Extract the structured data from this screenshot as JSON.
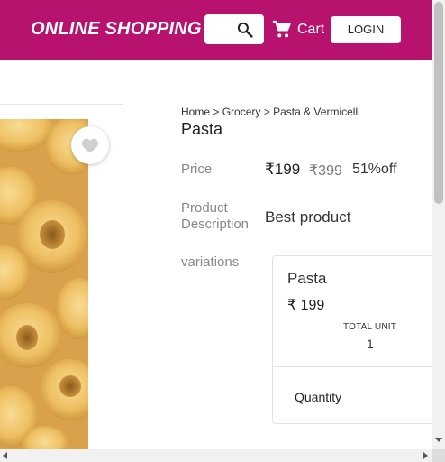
{
  "header": {
    "brand": "ONLINE SHOPPING",
    "cart_label": "Cart",
    "login_label": "LOGIN",
    "search_icon": "search-icon",
    "cart_icon": "shopping-cart-icon",
    "bg_color": "#b8126f"
  },
  "breadcrumb": {
    "home": "Home",
    "sep1": " > ",
    "grocery": "Grocery",
    "sep2": " > ",
    "category": "Pasta & Vermicelli"
  },
  "product": {
    "title": "Pasta",
    "price_label": "Price",
    "price": "₹199",
    "mrp": "₹399",
    "discount": "51%off",
    "description_label_line1": "Product",
    "description_label_line2": "Description",
    "description": "Best product",
    "variations_label": "variations",
    "wishlist_icon": "heart-icon"
  },
  "variation": {
    "name": "Pasta",
    "price": "₹ 199",
    "total_unit_label": "TOTAL UNIT",
    "total_unit_value": "1",
    "quantity_label": "Quantity"
  }
}
